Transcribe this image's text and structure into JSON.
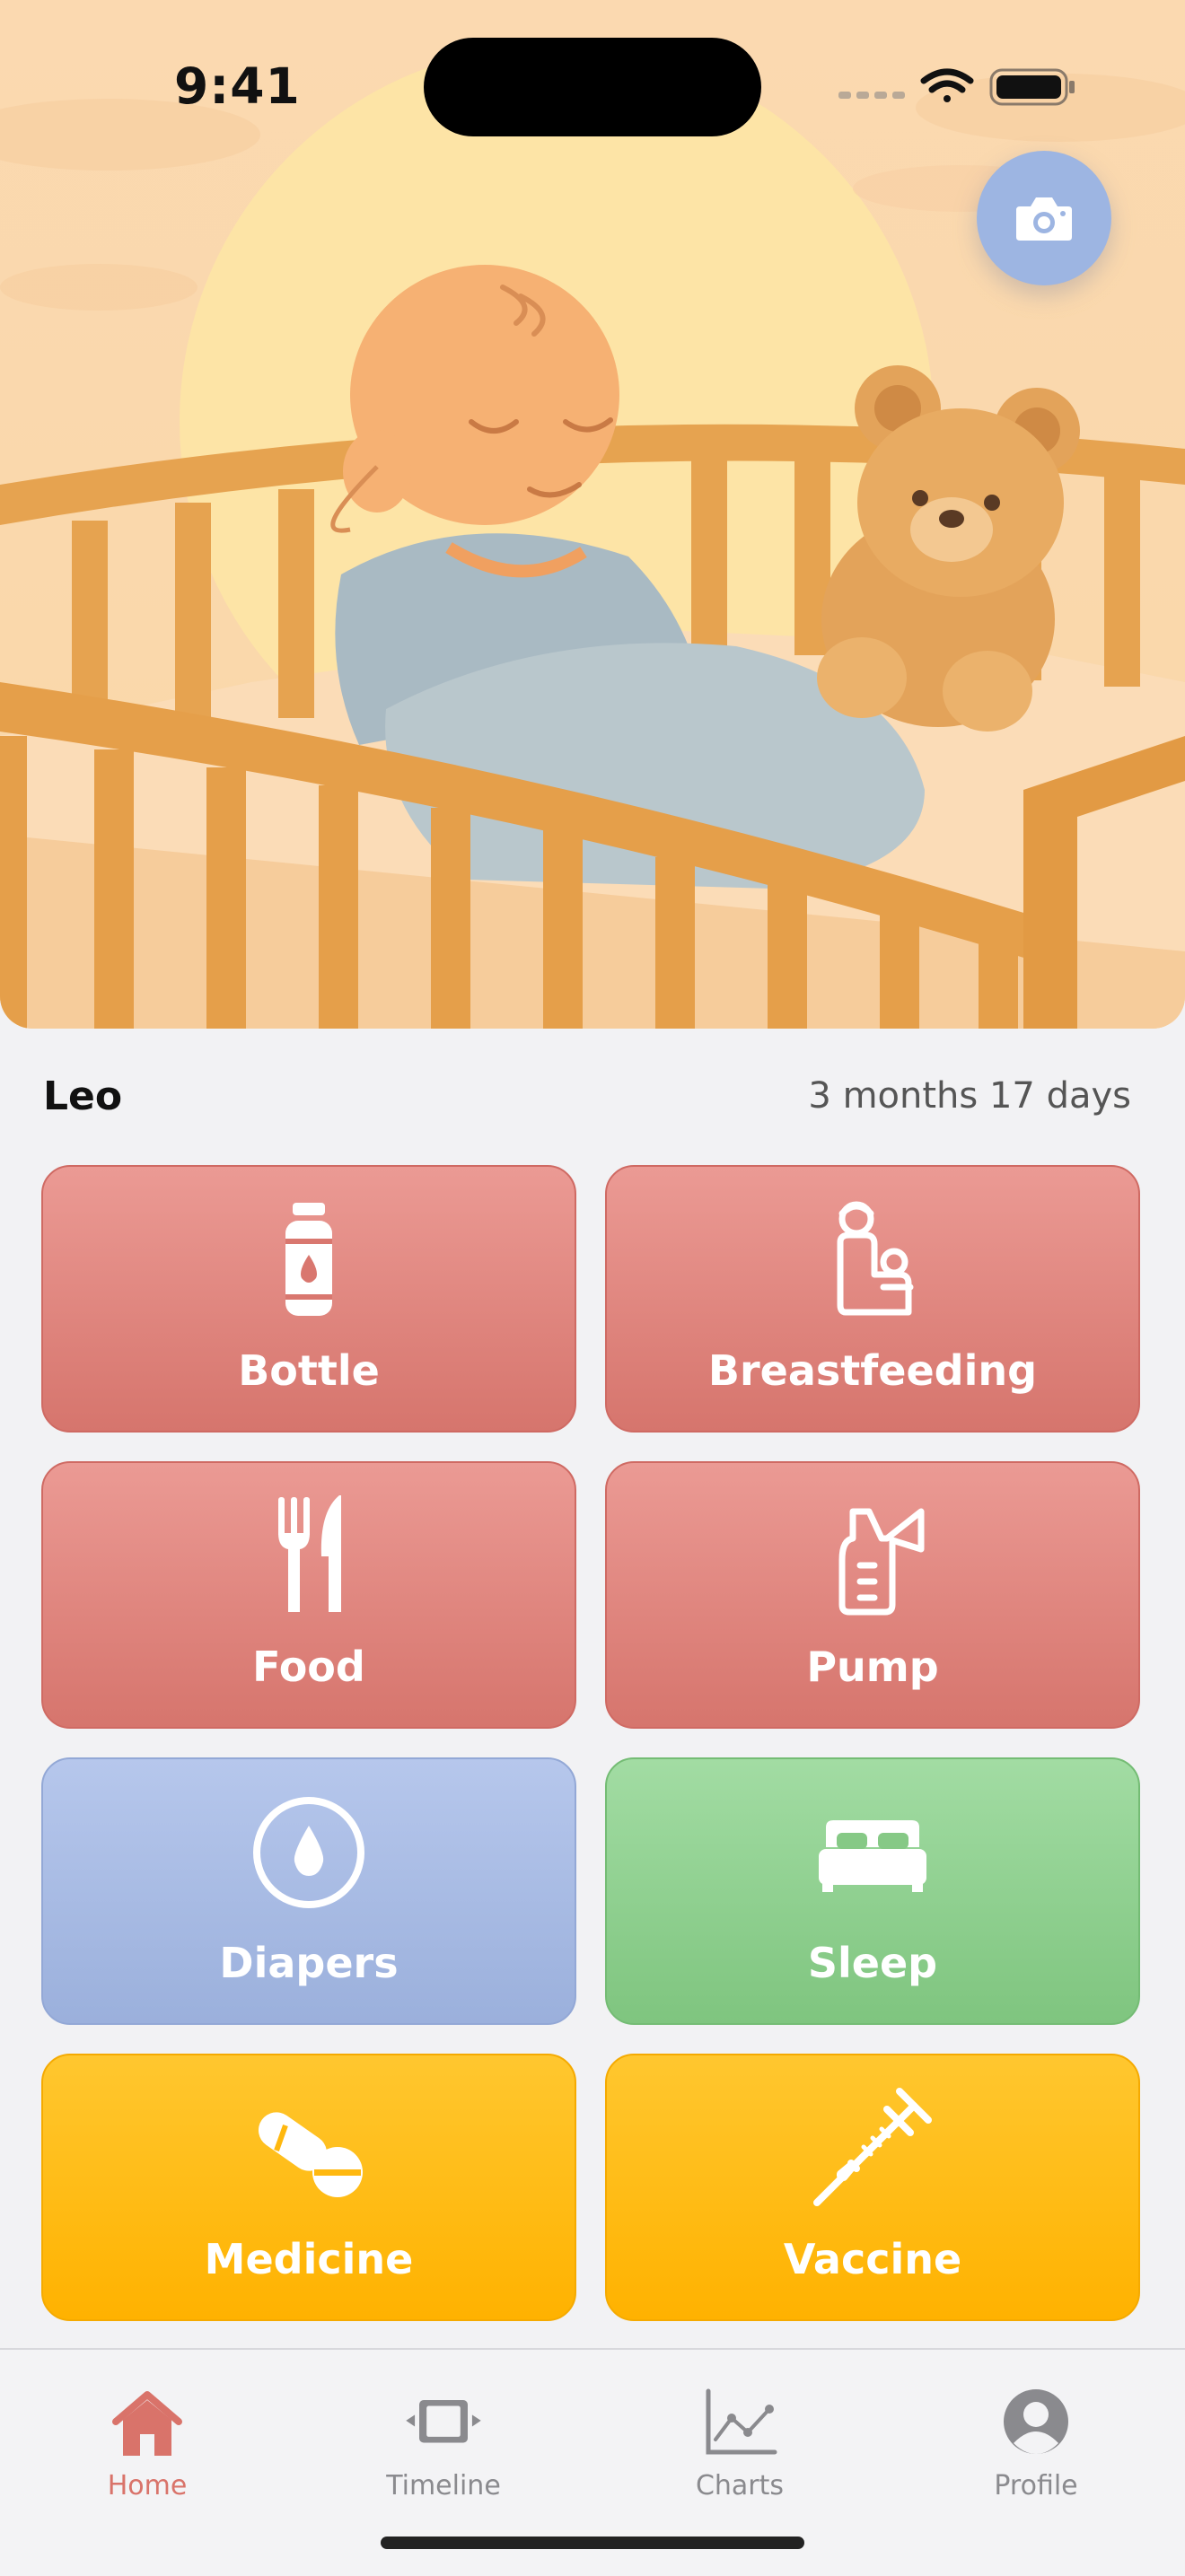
{
  "status_bar": {
    "time": "9:41"
  },
  "child": {
    "name": "Leo",
    "age": "3 months 17 days"
  },
  "tiles": [
    {
      "label": "Bottle",
      "icon": "bottle-icon",
      "color": "#dc7e76"
    },
    {
      "label": "Breastfeeding",
      "icon": "breastfeeding-icon",
      "color": "#dc7e76"
    },
    {
      "label": "Food",
      "icon": "fork-knife-icon",
      "color": "#dc7e76"
    },
    {
      "label": "Pump",
      "icon": "breast-pump-icon",
      "color": "#dc7e76"
    },
    {
      "label": "Diapers",
      "icon": "drop-icon",
      "color": "#a3b6e0"
    },
    {
      "label": "Sleep",
      "icon": "bed-icon",
      "color": "#86c986"
    },
    {
      "label": "Medicine",
      "icon": "pills-icon",
      "color": "#ffb80f"
    },
    {
      "label": "Vaccine",
      "icon": "syringe-icon",
      "color": "#ffb80f"
    }
  ],
  "tabbar": {
    "active": "Home",
    "accent": "#d9736a",
    "items": [
      {
        "label": "Home",
        "icon": "home-icon"
      },
      {
        "label": "Timeline",
        "icon": "timeline-icon"
      },
      {
        "label": "Charts",
        "icon": "chart-icon"
      },
      {
        "label": "Profile",
        "icon": "profile-icon"
      }
    ]
  }
}
